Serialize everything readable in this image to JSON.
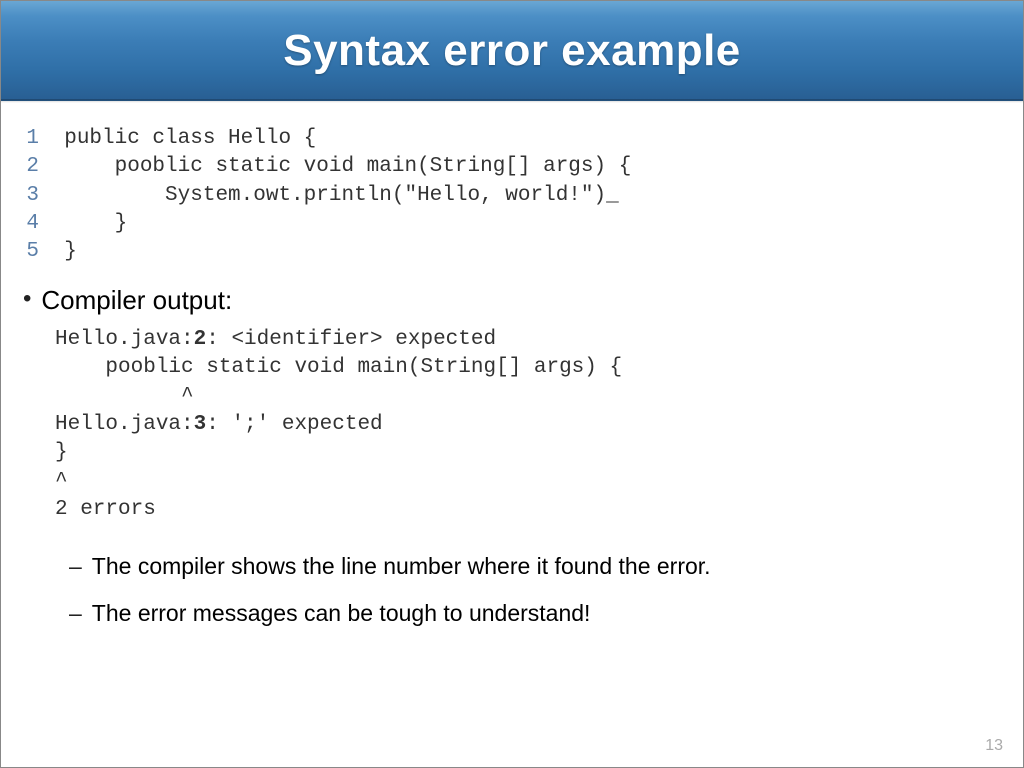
{
  "title": "Syntax error example",
  "code_lines": [
    {
      "n": "1",
      "text": "public class Hello {"
    },
    {
      "n": "2",
      "text": "    pooblic static void main(String[] args) {"
    },
    {
      "n": "3",
      "text": "        System.owt.println(\"Hello, world!\")_"
    },
    {
      "n": "4",
      "text": "    }"
    },
    {
      "n": "5",
      "text": "}"
    }
  ],
  "bullet_label": "Compiler output:",
  "output_lines": [
    {
      "text": "Hello.java:",
      "bold": "2",
      "rest": ": <identifier> expected"
    },
    {
      "text": "    pooblic static void main(String[] args) {"
    },
    {
      "text": "          ^"
    },
    {
      "text": "Hello.java:",
      "bold": "3",
      "rest": ": ';' expected"
    },
    {
      "text": "}"
    },
    {
      "text": "^"
    },
    {
      "text": "2 errors"
    }
  ],
  "notes": [
    "The compiler shows the line number where it found the error.",
    "The error messages can be tough to understand!"
  ],
  "page_number": "13"
}
